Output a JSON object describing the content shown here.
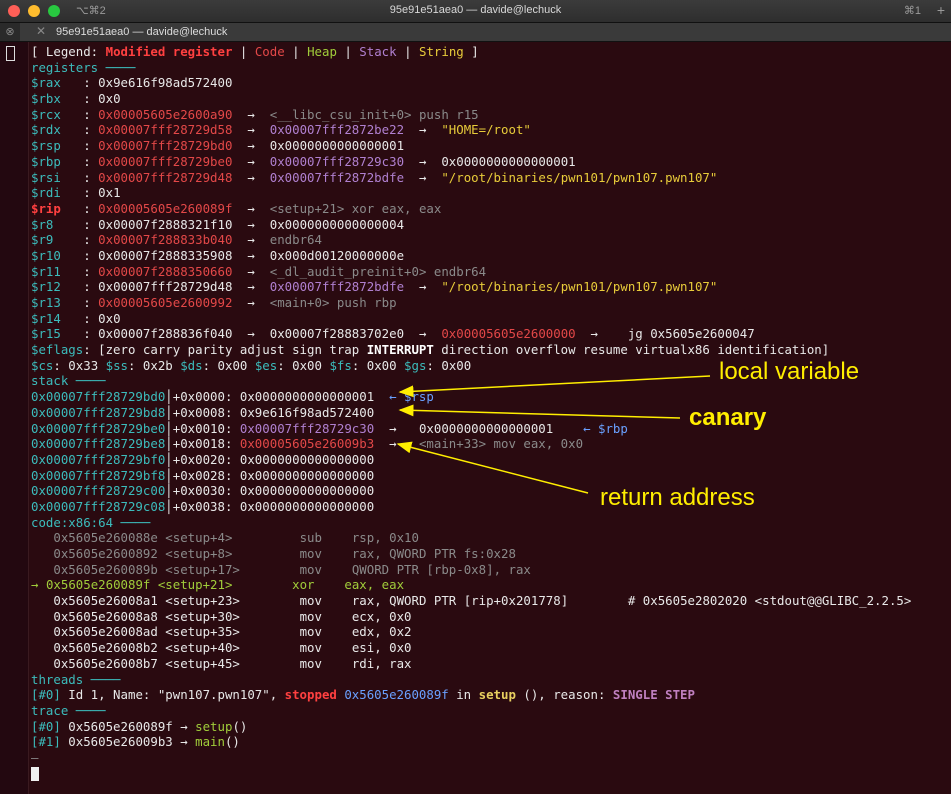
{
  "window": {
    "title": "95e91e51aea0 — davide@lechuck",
    "left_shortcut": "⌥⌘2",
    "right_shortcut": "⌘1",
    "tab_title": "95e91e51aea0 — davide@lechuck",
    "tab_close": "✕",
    "new_tab": "+"
  },
  "colors": {
    "background": "#2a0a10",
    "modified": "#e34848",
    "code": "#e34848",
    "heap": "#a0cc3a",
    "stack": "#b080d0",
    "string": "#e8cc3a",
    "annotation": "#ffee00"
  },
  "legend": {
    "prefix": "[ Legend: ",
    "modified": "Modified register",
    "code": "Code",
    "heap": "Heap",
    "stack": "Stack",
    "string": "String",
    "suffix": " ]"
  },
  "headers": {
    "registers": "registers ────",
    "stack": "stack ────",
    "code": "code:x86:64 ────",
    "threads": "threads ────",
    "trace": "trace ────"
  },
  "registers": [
    {
      "name": "$rax",
      "value": "0x9e616f98ad572400",
      "rest": ""
    },
    {
      "name": "$rbx",
      "value": "0x0",
      "rest": ""
    },
    {
      "name": "$rcx",
      "value": "0x00005605e2600a90",
      "rest": "<__libc_csu_init+0> push r15"
    },
    {
      "name": "$rdx",
      "value": "0x00007fff28729d58",
      "v2": "0x00007fff2872be22",
      "rest": "\"HOME=/root\""
    },
    {
      "name": "$rsp",
      "value": "0x00007fff28729bd0",
      "v2": "0x0000000000000001",
      "rest": ""
    },
    {
      "name": "$rbp",
      "value": "0x00007fff28729be0",
      "v2": "0x00007fff28729c30",
      "rest": "0x0000000000000001"
    },
    {
      "name": "$rsi",
      "value": "0x00007fff28729d48",
      "v2": "0x00007fff2872bdfe",
      "rest": "\"/root/binaries/pwn101/pwn107.pwn107\""
    },
    {
      "name": "$rdi",
      "value": "0x1",
      "rest": ""
    },
    {
      "name": "$rip",
      "value": "0x00005605e260089f",
      "rest": "<setup+21> xor eax, eax"
    },
    {
      "name": "$r8",
      "value": "0x00007f2888321f10",
      "v2": "0x0000000000000004",
      "rest": ""
    },
    {
      "name": "$r9",
      "value": "0x00007f288833b040",
      "rest": "endbr64"
    },
    {
      "name": "$r10",
      "value": "0x00007f2888335908",
      "v2": "0x000d00120000000e",
      "rest": ""
    },
    {
      "name": "$r11",
      "value": "0x00007f2888350660",
      "rest": "<_dl_audit_preinit+0> endbr64"
    },
    {
      "name": "$r12",
      "value": "0x00007fff28729d48",
      "v2": "0x00007fff2872bdfe",
      "rest": "\"/root/binaries/pwn101/pwn107.pwn107\""
    },
    {
      "name": "$r13",
      "value": "0x00005605e2600992",
      "rest": "<main+0> push rbp"
    },
    {
      "name": "$r14",
      "value": "0x0",
      "rest": ""
    },
    {
      "name": "$r15",
      "value": "0x00007f288836f040",
      "v2": "0x00007f28883702e0",
      "v3": "0x00005605e2600000",
      "rest": "jg 0x5605e2600047"
    }
  ],
  "eflags": {
    "label": "$eflags",
    "open": ": [zero carry parity adjust sign trap ",
    "flag": "INTERRUPT",
    "close": " direction overflow resume virtualx86 identification]"
  },
  "segments": [
    {
      "name": "$cs",
      "value": ": 0x33 "
    },
    {
      "name": "$ss",
      "value": ": 0x2b "
    },
    {
      "name": "$ds",
      "value": ": 0x00 "
    },
    {
      "name": "$es",
      "value": ": 0x00 "
    },
    {
      "name": "$fs",
      "value": ": 0x00 "
    },
    {
      "name": "$gs",
      "value": ": 0x00"
    }
  ],
  "stack": [
    {
      "addr": "0x00007fff28729bd0",
      "off": "+0x0000: ",
      "val": "0x0000000000000001",
      "extra": "",
      "mark": "← $rsp"
    },
    {
      "addr": "0x00007fff28729bd8",
      "off": "+0x0008: ",
      "val": "0x9e616f98ad572400",
      "extra": "",
      "mark": ""
    },
    {
      "addr": "0x00007fff28729be0",
      "off": "+0x0010: ",
      "val": "0x00007fff28729c30",
      "extra": "0x0000000000000001",
      "mark": "← $rbp"
    },
    {
      "addr": "0x00007fff28729be8",
      "off": "+0x0018: ",
      "val": "0x00005605e26009b3",
      "extra": "<main+33> mov eax, 0x0",
      "mark": ""
    },
    {
      "addr": "0x00007fff28729bf0",
      "off": "+0x0020: ",
      "val": "0x0000000000000000",
      "extra": "",
      "mark": ""
    },
    {
      "addr": "0x00007fff28729bf8",
      "off": "+0x0028: ",
      "val": "0x0000000000000000",
      "extra": "",
      "mark": ""
    },
    {
      "addr": "0x00007fff28729c00",
      "off": "+0x0030: ",
      "val": "0x0000000000000000",
      "extra": "",
      "mark": ""
    },
    {
      "addr": "0x00007fff28729c08",
      "off": "+0x0038: ",
      "val": "0x0000000000000000",
      "extra": "",
      "mark": ""
    }
  ],
  "code": [
    {
      "addr": "0x5605e260088e",
      "sym": "<setup+4>",
      "mn": "sub",
      "ops": "rsp, 0x10",
      "cm": ""
    },
    {
      "addr": "0x5605e2600892",
      "sym": "<setup+8>",
      "mn": "mov",
      "ops": "rax, QWORD PTR fs:0x28",
      "cm": ""
    },
    {
      "addr": "0x5605e260089b",
      "sym": "<setup+17>",
      "mn": "mov",
      "ops": "QWORD PTR [rbp-0x8], rax",
      "cm": ""
    },
    {
      "addr": "0x5605e260089f",
      "sym": "<setup+21>",
      "mn": "xor",
      "ops": "eax, eax",
      "cm": ""
    },
    {
      "addr": "0x5605e26008a1",
      "sym": "<setup+23>",
      "mn": "mov",
      "ops": "rax, QWORD PTR [rip+0x201778]",
      "cm": "# 0x5605e2802020 <stdout@@GLIBC_2.2.5>"
    },
    {
      "addr": "0x5605e26008a8",
      "sym": "<setup+30>",
      "mn": "mov",
      "ops": "ecx, 0x0",
      "cm": ""
    },
    {
      "addr": "0x5605e26008ad",
      "sym": "<setup+35>",
      "mn": "mov",
      "ops": "edx, 0x2",
      "cm": ""
    },
    {
      "addr": "0x5605e26008b2",
      "sym": "<setup+40>",
      "mn": "mov",
      "ops": "esi, 0x0",
      "cm": ""
    },
    {
      "addr": "0x5605e26008b7",
      "sym": "<setup+45>",
      "mn": "mov",
      "ops": "rdi, rax",
      "cm": ""
    }
  ],
  "code_current_arrow": "→",
  "threads": {
    "idx": "[#0]",
    "text1": " Id 1, Name: \"pwn107.pwn107\", ",
    "stopped": "stopped",
    "addr": " 0x5605e260089f",
    "in": " in ",
    "func": "setup",
    "text2": " (), reason: ",
    "reason": "SINGLE STEP"
  },
  "trace": [
    {
      "idx": "[#0]",
      "addr": " 0x5605e260089f → ",
      "func": "setup",
      "tail": "()"
    },
    {
      "idx": "[#1]",
      "addr": " 0x5605e26009b3 → ",
      "func": "main",
      "tail": "()"
    }
  ],
  "prompt_line": "—",
  "annotations": {
    "local": "local variable",
    "canary": "canary",
    "ret": "return address"
  }
}
